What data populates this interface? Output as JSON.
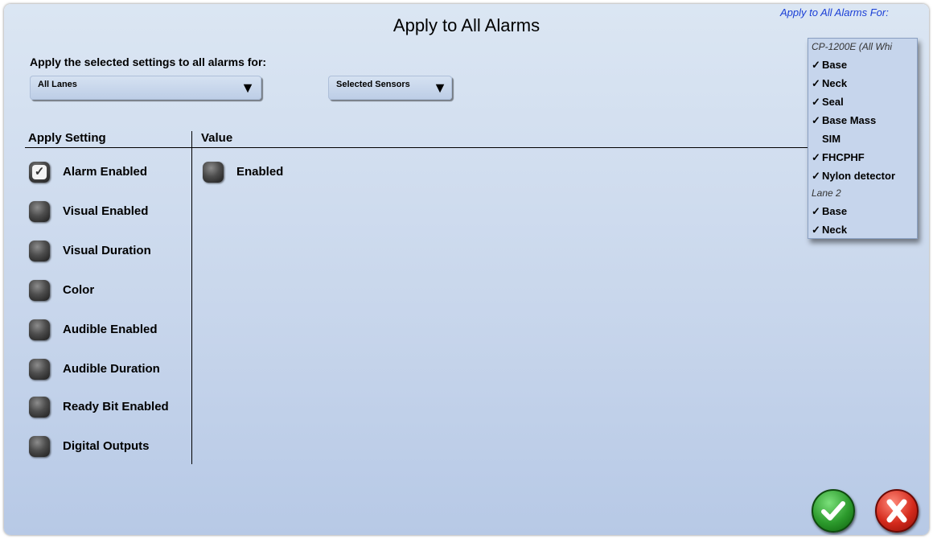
{
  "dialog": {
    "title": "Apply to All Alarms",
    "subheading": "Apply the selected settings to all alarms for:",
    "lanes_dropdown": {
      "value": "All Lanes",
      "arrow": "▼"
    },
    "sensors_dropdown": {
      "value": "Selected Sensors",
      "arrow": "▼"
    },
    "columns": {
      "apply": "Apply Setting",
      "value": "Value"
    },
    "settings": [
      {
        "label": "Alarm Enabled",
        "checked": true
      },
      {
        "label": "Visual Enabled",
        "checked": false
      },
      {
        "label": "Visual Duration",
        "checked": false
      },
      {
        "label": "Color",
        "checked": false
      },
      {
        "label": "Audible Enabled",
        "checked": false
      },
      {
        "label": "Audible Duration",
        "checked": false
      },
      {
        "label": "Ready Bit Enabled",
        "checked": false
      },
      {
        "label": "Digital Outputs",
        "checked": false
      }
    ],
    "value_option": {
      "label": "Enabled",
      "checked": false
    },
    "ok_button": "confirm-check-icon",
    "cancel_button": "cancel-x-icon"
  },
  "popup": {
    "title": "Apply to All Alarms For:",
    "items": [
      {
        "type": "group",
        "label": "CP-1200E (All Whi"
      },
      {
        "type": "item",
        "label": "Base",
        "check": "✓"
      },
      {
        "type": "item",
        "label": "Neck",
        "check": "✓"
      },
      {
        "type": "item",
        "label": "Seal",
        "check": "✓"
      },
      {
        "type": "item",
        "label": "Base Mass",
        "check": "✓"
      },
      {
        "type": "item",
        "label": "SIM",
        "check": ""
      },
      {
        "type": "item",
        "label": "FHCPHF",
        "check": "✓"
      },
      {
        "type": "item",
        "label": "Nylon detector",
        "check": "✓"
      },
      {
        "type": "group",
        "label": "Lane 2"
      },
      {
        "type": "item",
        "label": "Base",
        "check": "✓"
      },
      {
        "type": "item",
        "label": "Neck",
        "check": "✓"
      }
    ]
  },
  "colors": {
    "accent_blue": "#1a3fd6",
    "ok_green": "#2c9a2c",
    "cancel_red": "#d42a1c"
  }
}
